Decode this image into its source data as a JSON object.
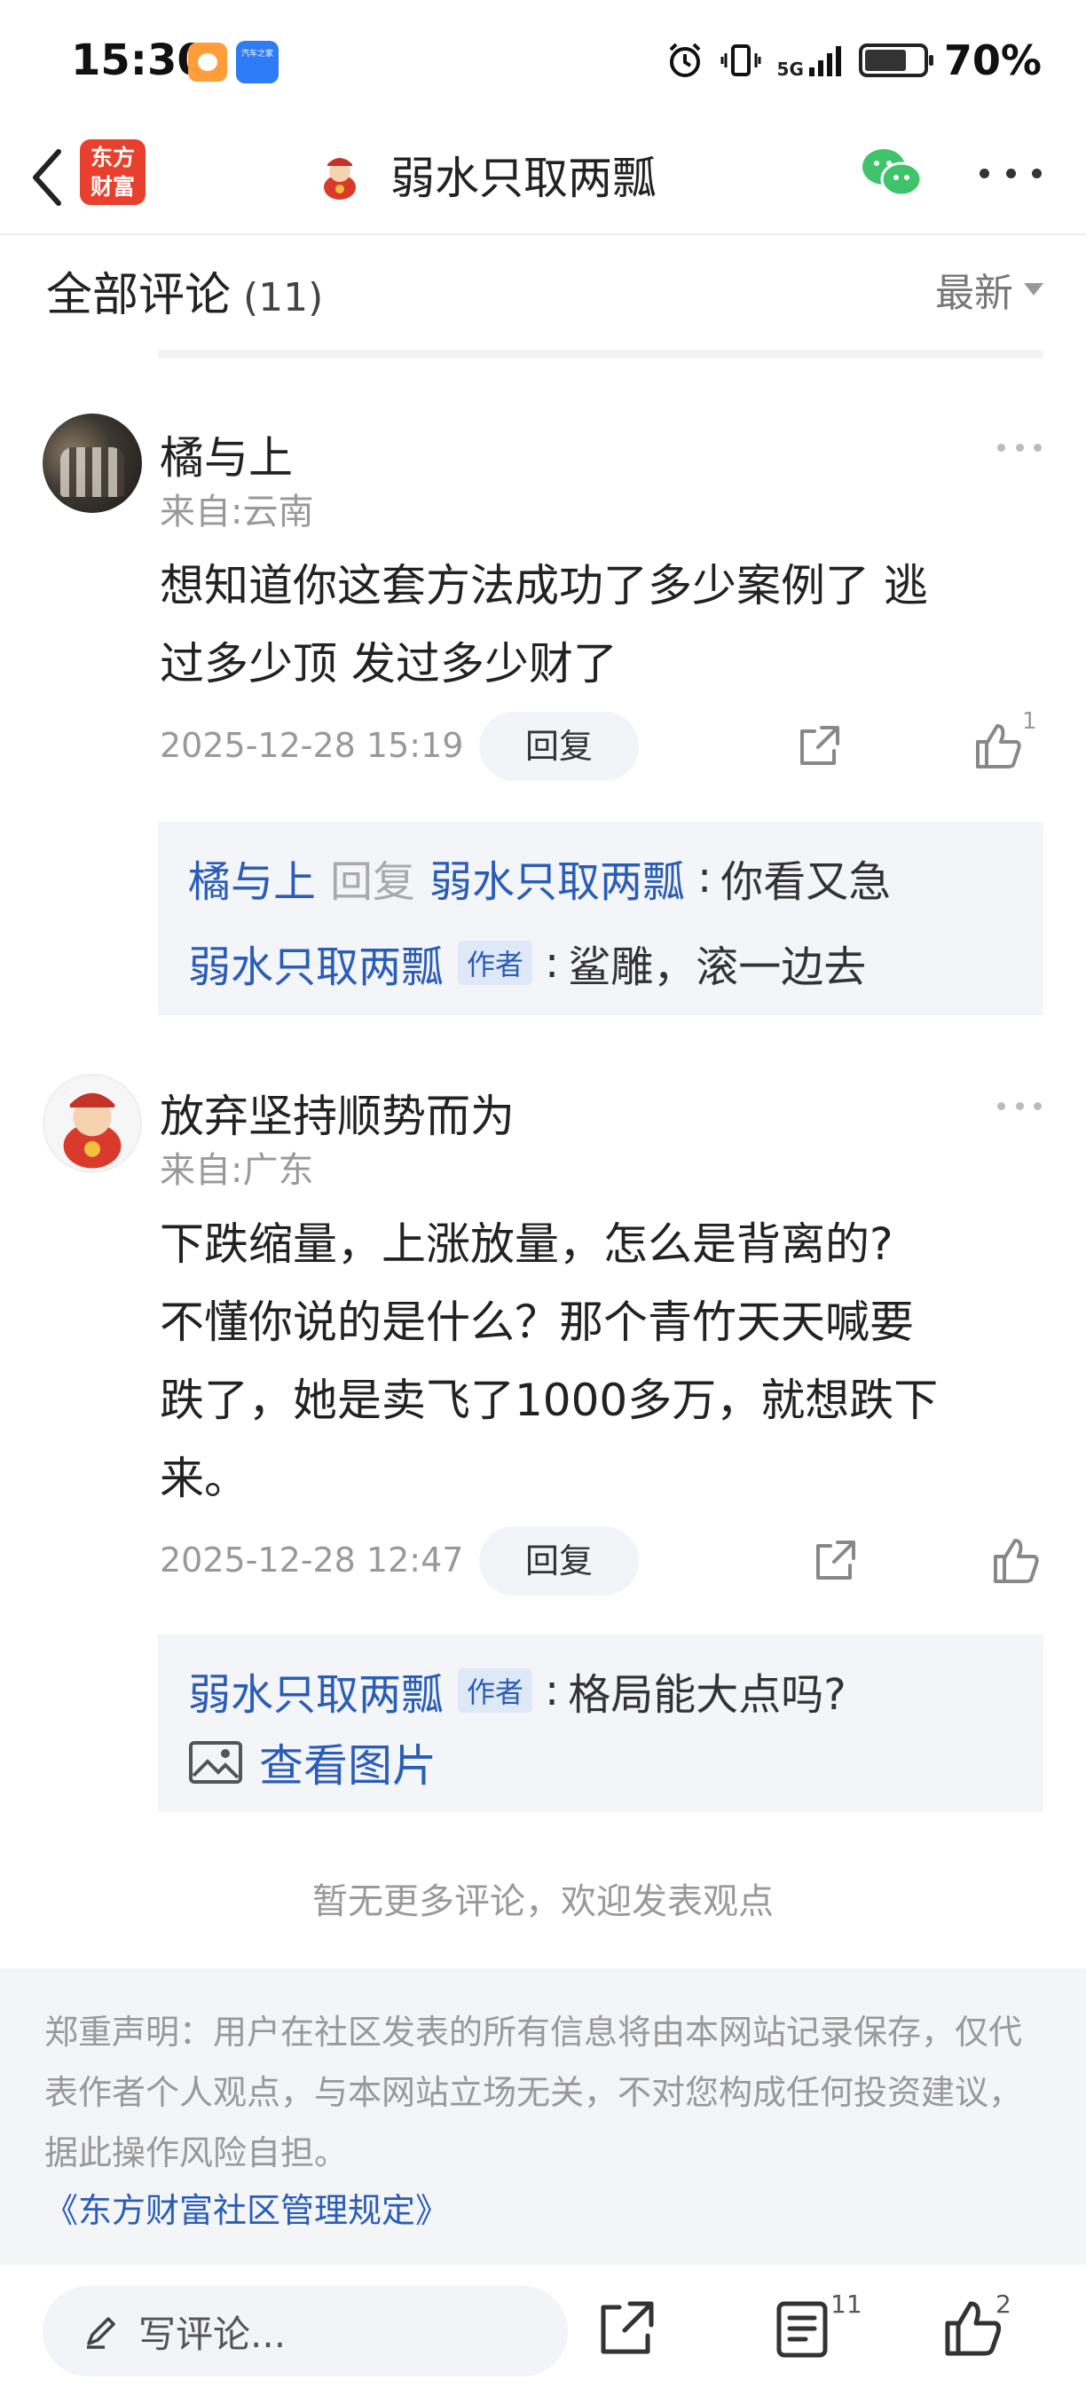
{
  "status_bar": {
    "time": "15:30",
    "app2_label": "汽车之家",
    "network": "5G",
    "battery": "70%",
    "battery_level": 0.7
  },
  "nav": {
    "logo_text": "东方财富",
    "title": "弱水只取两瓢",
    "wechat_icon_color": "#3fc46b"
  },
  "comments_header": {
    "label": "全部评论",
    "count": "(11)",
    "sort": "最新"
  },
  "comments": [
    {
      "name": "橘与上",
      "location": "来自:云南",
      "text_lines": [
        "想知道你这套方法成功了多少案例了 逃",
        "过多少顶 发过多少财了"
      ],
      "date": "2025-12-28 15:19",
      "reply_label": "回复",
      "like_count": "1",
      "replies": [
        {
          "from": "橘与上",
          "verb": "回复",
          "to": "弱水只取两瓢",
          "text": "你看又急"
        },
        {
          "from": "弱水只取两瓢",
          "tag": "作者",
          "text": "鲨雕，滚一边去"
        }
      ]
    },
    {
      "name": "放弃坚持顺势而为",
      "location": "来自:广东",
      "text_lines": [
        "下跌缩量，上涨放量，怎么是背离的?",
        "不懂你说的是什么？那个青竹天天喊要",
        "跌了，她是卖飞了1000多万，就想跌下",
        "来。"
      ],
      "date": "2025-12-28 12:47",
      "reply_label": "回复",
      "like_count": "",
      "replies": [
        {
          "from": "弱水只取两瓢",
          "tag": "作者",
          "text": "格局能大点吗?"
        }
      ],
      "view_image": "查看图片"
    }
  ],
  "no_more": "暂无更多评论，欢迎发表观点",
  "disclaimer": {
    "text": "郑重声明：用户在社区发表的所有信息将由本网站记录保存，仅代表作者个人观点，与本网站立场无关，不对您构成任何投资建议，据此操作风险自担。",
    "rules_link": "《东方财富社区管理规定》"
  },
  "bottom_bar": {
    "write_placeholder": "写评论...",
    "comment_count": "11",
    "like_count": "2"
  },
  "colors": {
    "link": "#2a5db8",
    "logo_red": "#e8402d",
    "reply_bg": "#f4f5f8"
  }
}
